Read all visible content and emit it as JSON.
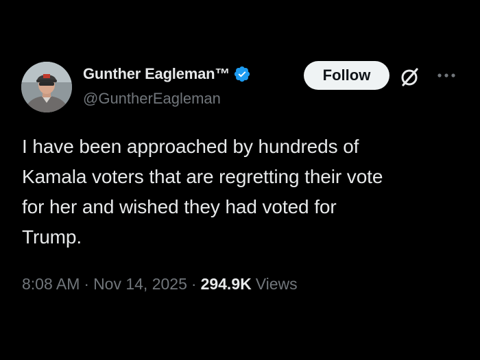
{
  "tweet": {
    "author": {
      "display_name": "Gunther Eagleman™",
      "handle": "@GuntherEagleman",
      "verified": true,
      "verified_color": "#1d9bf0"
    },
    "follow_label": "Follow",
    "more_icon": "ellipsis-icon",
    "grok_icon": "grok-icon",
    "text": "I have been approached by hundreds of\nKamala voters that are regretting their vote\nfor her and wished they had voted for\nTrump.",
    "time": "8:08 AM",
    "separator": "·",
    "date": "Nov 14, 2025",
    "views_count": "294.9K",
    "views_label": "Views"
  },
  "colors": {
    "background": "#000000",
    "primary_text": "#e7e9ea",
    "secondary_text": "#71767b",
    "follow_bg": "#eff3f4",
    "follow_text": "#0f1419"
  }
}
